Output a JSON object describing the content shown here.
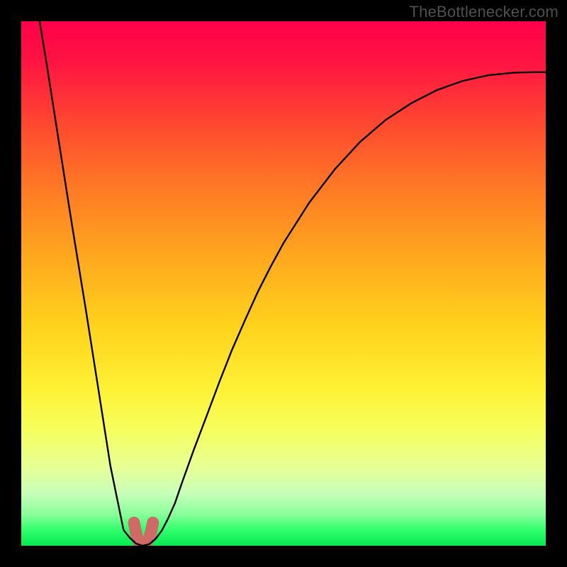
{
  "watermark": "TheBottlenecker.com",
  "chart_data": {
    "type": "line",
    "title": "",
    "xlabel": "",
    "ylabel": "",
    "xlim": [
      0,
      1
    ],
    "ylim": [
      0,
      1
    ],
    "grid": false,
    "series": [
      {
        "name": "bottleneck-curve",
        "color": "#000000",
        "x": [
          0.0,
          0.024,
          0.049,
          0.073,
          0.097,
          0.122,
          0.146,
          0.17,
          0.195,
          0.207,
          0.219,
          0.231,
          0.244,
          0.256,
          0.268,
          0.28,
          0.293,
          0.305,
          0.329,
          0.354,
          0.378,
          0.402,
          0.427,
          0.451,
          0.476,
          0.5,
          0.549,
          0.598,
          0.646,
          0.695,
          0.744,
          0.793,
          0.841,
          0.89,
          0.939,
          0.976,
          1.0
        ],
        "y": [
          1.22,
          1.067,
          0.915,
          0.762,
          0.61,
          0.457,
          0.305,
          0.152,
          0.03,
          0.015,
          0.004,
          0.0,
          0.003,
          0.013,
          0.029,
          0.052,
          0.081,
          0.116,
          0.183,
          0.249,
          0.313,
          0.374,
          0.431,
          0.484,
          0.533,
          0.577,
          0.654,
          0.718,
          0.77,
          0.812,
          0.844,
          0.869,
          0.886,
          0.897,
          0.902,
          0.903,
          0.903
        ]
      },
      {
        "name": "trough-marker",
        "color": "#cf6a66",
        "x": [
          0.215,
          0.219,
          0.223,
          0.226,
          0.232,
          0.238,
          0.244,
          0.248,
          0.251
        ],
        "y": [
          0.044,
          0.023,
          0.009,
          0.003,
          0.0,
          0.004,
          0.015,
          0.029,
          0.044
        ]
      }
    ]
  }
}
